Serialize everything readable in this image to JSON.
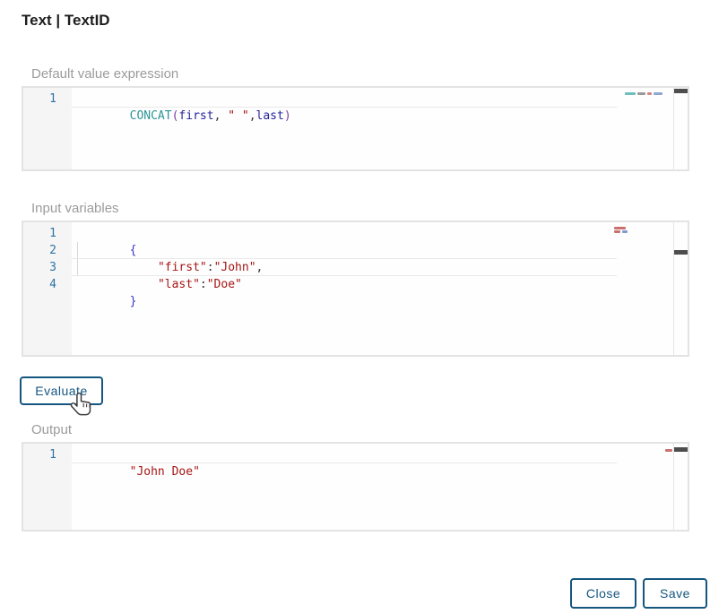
{
  "title": "Text | TextID",
  "colors": {
    "accent": "#15567f",
    "string_token": "#a31515",
    "function_token": "#2e9598",
    "variable_token": "#23239b",
    "paren_token": "#7b3fa4",
    "brace_token": "#3939cf",
    "line_number": "#2d74a4",
    "gutter_background": "#f5f5f5",
    "editor_border": "#e3e3e3",
    "label_gray": "#9b9b9b"
  },
  "buttons": {
    "evaluate": "Evaluate",
    "close": "Close",
    "save": "Save"
  },
  "expression_editor": {
    "label": "Default value expression",
    "lines": [
      {
        "num": "1",
        "text": "CONCAT(first, \" \",last)",
        "tokens": [
          {
            "t": "CONCAT"
          },
          {
            "t": "("
          },
          {
            "t": "first"
          },
          {
            "t": ", "
          },
          {
            "t": "\" \""
          },
          {
            "t": ","
          },
          {
            "t": "last"
          },
          {
            "t": ")"
          }
        ]
      }
    ]
  },
  "input_editor": {
    "label": "Input variables",
    "lines": [
      {
        "num": "1",
        "text": "{",
        "tokens": [
          {
            "t": "{"
          }
        ]
      },
      {
        "num": "2",
        "text": "    \"first\":\"John\",",
        "tokens": [
          {
            "t": "    "
          },
          {
            "t": "\"first\""
          },
          {
            "t": ":"
          },
          {
            "t": "\"John\""
          },
          {
            "t": ","
          }
        ]
      },
      {
        "num": "3",
        "text": "    \"last\":\"Doe\"",
        "tokens": [
          {
            "t": "    "
          },
          {
            "t": "\"last\""
          },
          {
            "t": ":"
          },
          {
            "t": "\"Doe\""
          }
        ]
      },
      {
        "num": "4",
        "text": "}",
        "tokens": [
          {
            "t": "}"
          }
        ]
      }
    ]
  },
  "output_editor": {
    "label": "Output",
    "lines": [
      {
        "num": "1",
        "text": "\"John Doe\"",
        "tokens": [
          {
            "t": "\"John Doe\""
          }
        ]
      }
    ]
  }
}
